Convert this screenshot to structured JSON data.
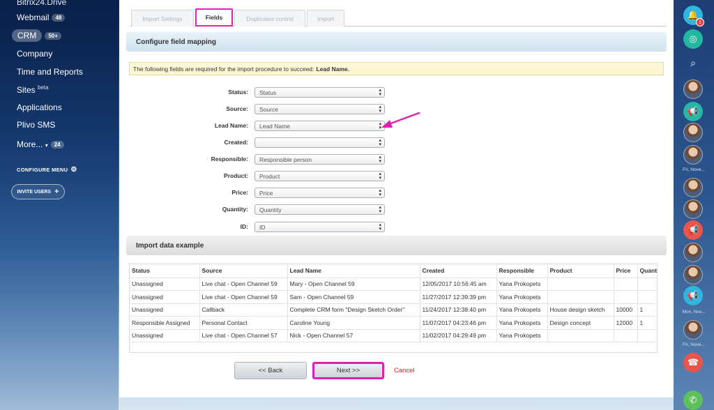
{
  "sidebar": {
    "items": [
      {
        "label": "Bitrix24.Drive"
      },
      {
        "label": "Webmail",
        "badge": "48"
      },
      {
        "label": "CRM",
        "badge": "50+"
      },
      {
        "label": "Company"
      },
      {
        "label": "Time and Reports"
      },
      {
        "label": "Sites",
        "suffix": "beta"
      },
      {
        "label": "Applications"
      },
      {
        "label": "Plivo SMS"
      },
      {
        "label": "More...",
        "badge": "24"
      }
    ],
    "configure_menu": "CONFIGURE MENU",
    "invite_users": "INVITE USERS"
  },
  "tabs": [
    {
      "label": "Import Settings",
      "active": false
    },
    {
      "label": "Fields",
      "active": true
    },
    {
      "label": "Duplicates control",
      "active": false
    },
    {
      "label": "Import",
      "active": false
    }
  ],
  "mapping": {
    "title": "Configure field mapping",
    "notice_text": "The following fields are required for the import procedure to succeed:",
    "notice_required": "Lead Name.",
    "fields": [
      {
        "label": "Status:",
        "value": "Status"
      },
      {
        "label": "Source:",
        "value": "Source"
      },
      {
        "label": "Lead Name:",
        "value": "Lead Name"
      },
      {
        "label": "Created:",
        "value": ""
      },
      {
        "label": "Responsible:",
        "value": "Responsible person"
      },
      {
        "label": "Product:",
        "value": "Product"
      },
      {
        "label": "Price:",
        "value": "Price"
      },
      {
        "label": "Quantity:",
        "value": "Quantity"
      },
      {
        "label": "ID:",
        "value": "ID"
      }
    ]
  },
  "example": {
    "title": "Import data example",
    "columns": [
      "Status",
      "Source",
      "Lead Name",
      "Created",
      "Responsible",
      "Product",
      "Price",
      "Quantity"
    ],
    "rows": [
      [
        "Unassigned",
        "Live chat - Open Channel 59",
        "Mary - Open Channel 59",
        "12/05/2017 10:56:45 am",
        "Yana Prokopets",
        "",
        "",
        ""
      ],
      [
        "Unassigned",
        "Live chat - Open Channel 59",
        "Sam - Open Channel 59",
        "11/27/2017 12:39:39 pm",
        "Yana Prokopets",
        "",
        "",
        ""
      ],
      [
        "Unassigned",
        "Callback",
        "Complete CRM form \"Design Sketch Order\"",
        "11/24/2017 12:38:40 pm",
        "Yana Prokopets",
        "House design sketch",
        "10000",
        "1"
      ],
      [
        "Responsible Assigned",
        "Personal Contact",
        "Caroline Young",
        "11/07/2017 04:23:46 pm",
        "Yana Prokopets",
        "Design concept",
        "12000",
        "1"
      ],
      [
        "Unassigned",
        "Live chat - Open Channel 57",
        "Nick - Open Channel 57",
        "11/02/2017 04:29:49 pm",
        "Yana Prokopets",
        "",
        "",
        ""
      ]
    ]
  },
  "buttons": {
    "back": "<< Back",
    "next": "Next >>",
    "cancel": "Cancel"
  },
  "rightbar": {
    "notification_count": "1",
    "labels": [
      "Fri, Nove...",
      "Mon, Nov...",
      "Fri, Nove..."
    ]
  },
  "colors": {
    "highlight": "#e21fb1",
    "cancel": "#d11b1b"
  }
}
